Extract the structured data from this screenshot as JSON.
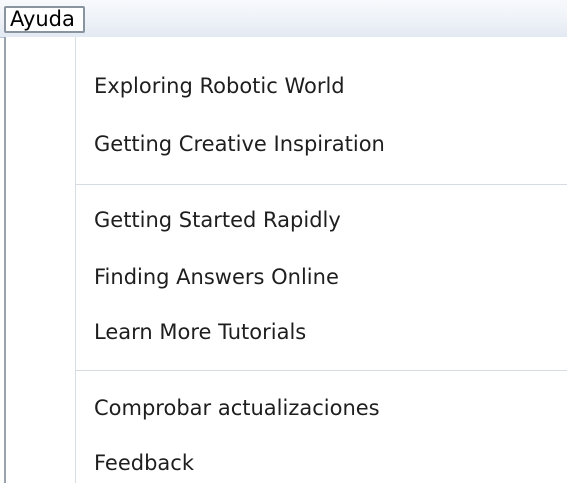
{
  "menu": {
    "title": "Ayuda",
    "groups": [
      [
        "Exploring Robotic World",
        "Getting Creative Inspiration"
      ],
      [
        "Getting Started Rapidly",
        "Finding Answers Online",
        "Learn More Tutorials"
      ],
      [
        "Comprobar actualizaciones",
        "Feedback"
      ]
    ]
  }
}
